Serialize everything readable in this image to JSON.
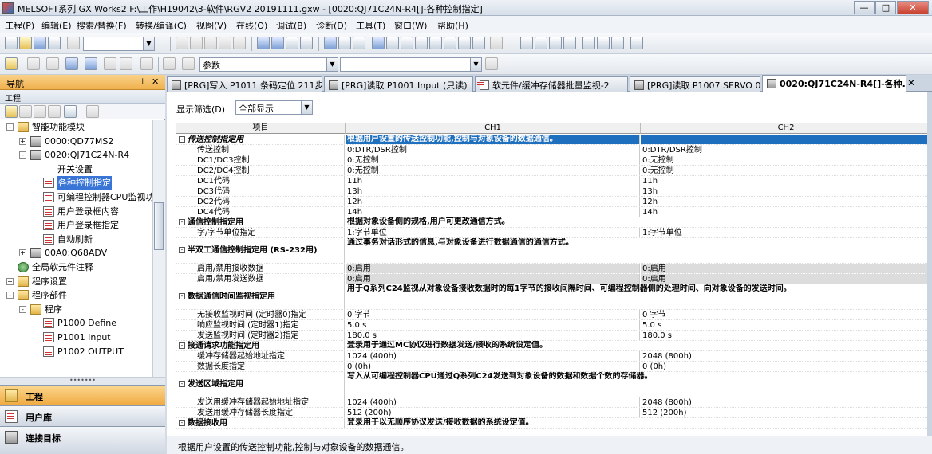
{
  "window": {
    "title": "MELSOFT系列 GX Works2 F:\\工作\\H19042\\3-软件\\RGV2 20191111.gxw - [0020:QJ71C24N-R4[]-各种控制指定]"
  },
  "menu": [
    "工程(P)",
    "编辑(E)",
    "搜索/替换(F)",
    "转换/编译(C)",
    "视图(V)",
    "在线(O)",
    "调试(B)",
    "诊断(D)",
    "工具(T)",
    "窗口(W)",
    "帮助(H)"
  ],
  "toolbar": {
    "param_combo": "参数"
  },
  "navigation": {
    "title": "导航",
    "section": "工程",
    "tree": [
      {
        "label": "智能功能模块",
        "level": 0
      },
      {
        "label": "0000:QD77MS2",
        "level": 1
      },
      {
        "label": "0020:QJ71C24N-R4",
        "level": 1
      },
      {
        "label": "开关设置",
        "level": 2
      },
      {
        "label": "各种控制指定",
        "level": 2,
        "selected": true
      },
      {
        "label": "可编程控制器CPU监视功",
        "level": 2
      },
      {
        "label": "用户登录框内容",
        "level": 2
      },
      {
        "label": "用户登录框指定",
        "level": 2
      },
      {
        "label": "自动刷新",
        "level": 2
      },
      {
        "label": "00A0:Q68ADV",
        "level": 1
      },
      {
        "label": "全局软元件注释",
        "level": 0
      },
      {
        "label": "程序设置",
        "level": 0
      },
      {
        "label": "程序部件",
        "level": 0
      },
      {
        "label": "程序",
        "level": 1
      },
      {
        "label": "P1000 Define",
        "level": 2
      },
      {
        "label": "P1001 Input",
        "level": 2
      },
      {
        "label": "P1002 OUTPUT",
        "level": 2
      }
    ],
    "buttons": [
      "工程",
      "用户库",
      "连接目标"
    ]
  },
  "tabs": [
    "[PRG]写入 P1011 条码定位 211步",
    "[PRG]读取 P1001 Input (只读)",
    "软元件/缓冲存储器批量监视-2",
    "[PRG]读取 P1007 SERVO 01 (",
    "0020:QJ71C24N-R4[]-各种..."
  ],
  "filter": {
    "label": "显示筛选(D)",
    "value": "全部显示"
  },
  "grid": {
    "headers": [
      "项目",
      "CH1",
      "CH2"
    ],
    "rows": [
      {
        "type": "cat",
        "item": "传送控制指定用",
        "ch1": "根据用户设置的传送控制功能,控制与对象设备的数据通信。",
        "ch2": "",
        "h": 13,
        "highlight": true,
        "first": true
      },
      {
        "type": "item",
        "item": "传送控制",
        "ch1": "0:DTR/DSR控制",
        "ch2": "0:DTR/DSR控制",
        "h": 13
      },
      {
        "type": "item",
        "item": "DC1/DC3控制",
        "ch1": "0:无控制",
        "ch2": "0:无控制",
        "h": 13
      },
      {
        "type": "item",
        "item": "DC2/DC4控制",
        "ch1": "0:无控制",
        "ch2": "0:无控制",
        "h": 13
      },
      {
        "type": "item",
        "item": "DC1代码",
        "ch1": "11h",
        "ch2": "11h",
        "h": 13
      },
      {
        "type": "item",
        "item": "DC3代码",
        "ch1": "13h",
        "ch2": "13h",
        "h": 13
      },
      {
        "type": "item",
        "item": "DC2代码",
        "ch1": "12h",
        "ch2": "12h",
        "h": 13
      },
      {
        "type": "item",
        "item": "DC4代码",
        "ch1": "14h",
        "ch2": "14h",
        "h": 13
      },
      {
        "type": "cat",
        "item": "通信控制指定用",
        "ch1": "根据对象设备侧的规格,用户可更改通信方式。",
        "ch2": "",
        "h": 13
      },
      {
        "type": "item",
        "item": "字/字节单位指定",
        "ch1": "1:字节单位",
        "ch2": "1:字节单位",
        "h": 13
      },
      {
        "type": "cat",
        "item": "半双工通信控制指定用 (RS-232用)",
        "ch1": "通过事务对话形式的信息,与对象设备进行数据通信的通信方式。",
        "ch2": "",
        "h": 32
      },
      {
        "type": "item",
        "item": "启用/禁用接收数据",
        "ch1": "0:启用",
        "ch2": "0:启用",
        "h": 13,
        "gray": true
      },
      {
        "type": "item",
        "item": "启用/禁用发送数据",
        "ch1": "0:启用",
        "ch2": "0:启用",
        "h": 13,
        "gray": true
      },
      {
        "type": "cat",
        "item": "数据通信时间监视指定用",
        "ch1": "用于Q系列C24监视从对象设备接收数据时的每1字节的接收间隔时间、可编程控制器侧的处理时间、向对象设备的发送时间。",
        "ch2": "",
        "h": 32
      },
      {
        "type": "item",
        "item": "无接收监视时间 (定时器0)指定",
        "ch1": "0 字节",
        "ch2": "0 字节",
        "h": 13
      },
      {
        "type": "item",
        "item": "响应监视时间 (定时器1)指定",
        "ch1": "5.0 s",
        "ch2": "5.0 s",
        "h": 13
      },
      {
        "type": "item",
        "item": "发送监视时间 (定时器2)指定",
        "ch1": "180.0 s",
        "ch2": "180.0 s",
        "h": 13
      },
      {
        "type": "cat",
        "item": "接通请求功能指定用",
        "ch1": "登录用于通过MC协议进行数据发送/接收的系统设定值。",
        "ch2": "",
        "h": 13
      },
      {
        "type": "item",
        "item": "缓冲存储器起始地址指定",
        "ch1": "1024 (400h)",
        "ch2": "2048 (800h)",
        "h": 13
      },
      {
        "type": "item",
        "item": "数据长度指定",
        "ch1": "0 (0h)",
        "ch2": "0 (0h)",
        "h": 13
      },
      {
        "type": "cat",
        "item": "发送区域指定用",
        "ch1": "写入从可编程控制器CPU通过Q系列C24发送到对象设备的数据和数据个数的存储器。",
        "ch2": "",
        "h": 32
      },
      {
        "type": "item",
        "item": "发送用缓冲存储器起始地址指定",
        "ch1": "1024 (400h)",
        "ch2": "2048 (800h)",
        "h": 13
      },
      {
        "type": "item",
        "item": "发送用缓冲存储器长度指定",
        "ch1": "512 (200h)",
        "ch2": "512 (200h)",
        "h": 13
      },
      {
        "type": "cat",
        "item": "数据接收用",
        "ch1": "登录用于以无顺序协议发送/接收数据的系统设定值。",
        "ch2": "",
        "h": 13
      }
    ]
  },
  "status": {
    "text": "根据用户设置的传送控制功能,控制与对象设备的数据通信。"
  },
  "colors": {
    "highlight": "#1f6fbf",
    "nav_header": "#f0b04c",
    "tab_strip": "#cbd5e1"
  }
}
